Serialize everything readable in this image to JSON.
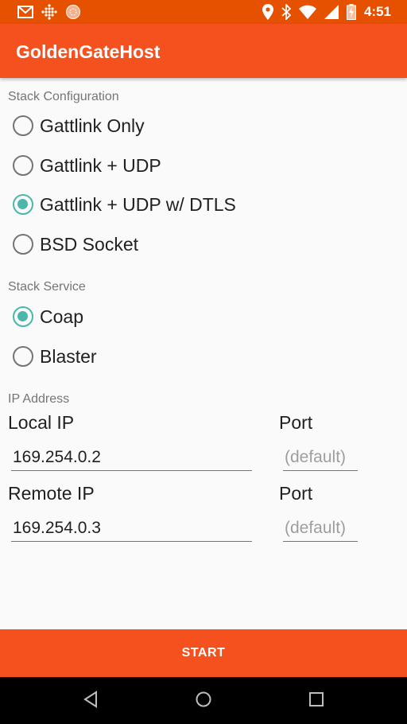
{
  "status_bar": {
    "time": "4:51",
    "left_icons": [
      "gmail-icon",
      "dots-grid-icon",
      "circle-pattern-icon"
    ],
    "right_icons": [
      "location-icon",
      "bluetooth-icon",
      "wifi-icon",
      "signal-icon",
      "battery-charging-icon"
    ]
  },
  "app_bar": {
    "title": "GoldenGateHost"
  },
  "stack_configuration": {
    "label": "Stack Configuration",
    "options": [
      {
        "label": "Gattlink Only",
        "checked": false
      },
      {
        "label": "Gattlink + UDP",
        "checked": false
      },
      {
        "label": "Gattlink + UDP w/ DTLS",
        "checked": true
      },
      {
        "label": "BSD Socket",
        "checked": false
      }
    ]
  },
  "stack_service": {
    "label": "Stack Service",
    "options": [
      {
        "label": "Coap",
        "checked": true
      },
      {
        "label": "Blaster",
        "checked": false
      }
    ]
  },
  "ip_address": {
    "label": "IP Address",
    "local": {
      "label": "Local IP",
      "value": "169.254.0.2",
      "port_label": "Port",
      "port_placeholder": "(default)"
    },
    "remote": {
      "label": "Remote IP",
      "value": "169.254.0.3",
      "port_label": "Port",
      "port_placeholder": "(default)"
    }
  },
  "start_button": {
    "label": "START"
  },
  "colors": {
    "status_bar": "#e65100",
    "app_bar": "#f4511e",
    "radio_checked": "#4db6ac",
    "background": "#fafafa"
  }
}
